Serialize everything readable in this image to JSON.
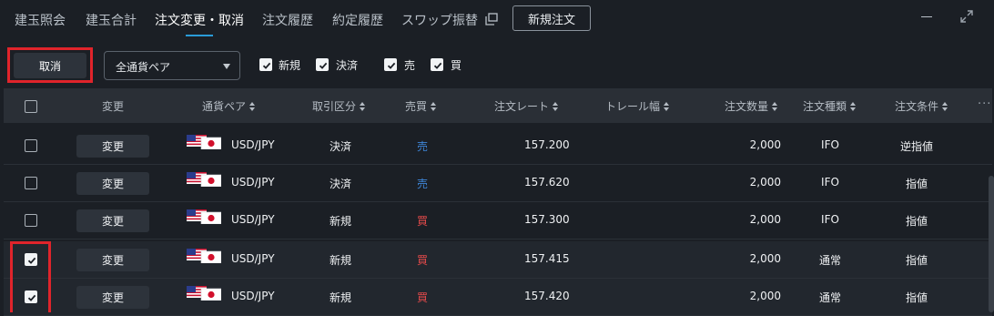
{
  "tabs": [
    "建玉照会",
    "建玉合計",
    "注文変更・取消",
    "注文履歴",
    "約定履歴",
    "スワップ振替"
  ],
  "active_tab": "注文変更・取消",
  "new_order_label": "新規注文",
  "toolbar": {
    "cancel_label": "取消",
    "currency_select": "全通貨ペア",
    "filters": [
      {
        "label": "新規",
        "checked": true
      },
      {
        "label": "決済",
        "checked": true
      },
      {
        "label": "売",
        "checked": true
      },
      {
        "label": "買",
        "checked": true
      }
    ]
  },
  "columns": {
    "change": "変更",
    "pair": "通貨ペア",
    "category": "取引区分",
    "buysell": "売買",
    "rate": "注文レート",
    "trail": "トレール幅",
    "qty": "注文数量",
    "type": "注文種類",
    "condition": "注文条件"
  },
  "change_label": "変更",
  "rows": [
    {
      "checked": false,
      "pair": "USD/JPY",
      "category": "決済",
      "buysell": "売",
      "rate": "157.200",
      "trail": "",
      "qty": "2,000",
      "type": "IFO",
      "condition": "逆指値"
    },
    {
      "checked": false,
      "pair": "USD/JPY",
      "category": "決済",
      "buysell": "売",
      "rate": "157.620",
      "trail": "",
      "qty": "2,000",
      "type": "IFO",
      "condition": "指値"
    },
    {
      "checked": false,
      "pair": "USD/JPY",
      "category": "新規",
      "buysell": "買",
      "rate": "157.300",
      "trail": "",
      "qty": "2,000",
      "type": "IFO",
      "condition": "指値"
    },
    {
      "checked": true,
      "pair": "USD/JPY",
      "category": "新規",
      "buysell": "買",
      "rate": "157.415",
      "trail": "",
      "qty": "2,000",
      "type": "通常",
      "condition": "指値"
    },
    {
      "checked": true,
      "pair": "USD/JPY",
      "category": "新規",
      "buysell": "買",
      "rate": "157.420",
      "trail": "",
      "qty": "2,000",
      "type": "通常",
      "condition": "指値"
    }
  ],
  "colors": {
    "accent": "#2a9bd8",
    "sell": "#3e86d8",
    "buy": "#e24a4a",
    "highlight": "#e0242b"
  }
}
